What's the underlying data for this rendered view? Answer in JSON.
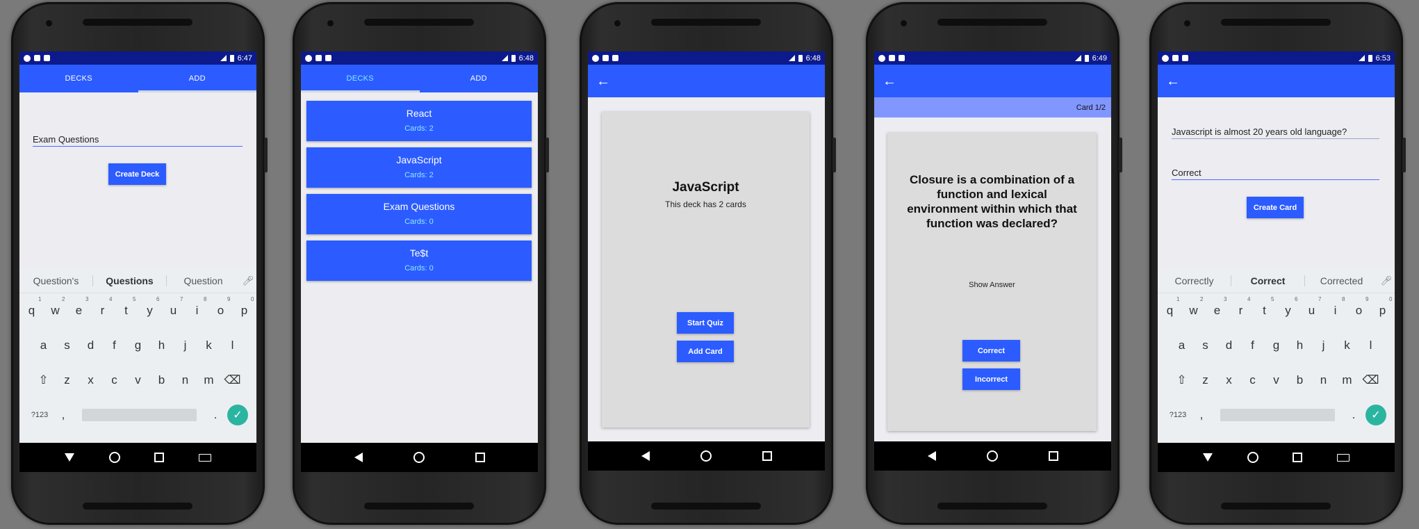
{
  "screens": [
    {
      "time": "6:47",
      "tabs": [
        "DECKS",
        "ADD"
      ],
      "active_tab": 1,
      "deck_title_value": "Exam Questions",
      "create_button": "Create Deck",
      "suggestions": [
        "Question's",
        "Questions",
        "Question"
      ]
    },
    {
      "time": "6:48",
      "tabs": [
        "DECKS",
        "ADD"
      ],
      "active_tab": 0,
      "decks": [
        {
          "title": "React",
          "cards": "Cards: 2"
        },
        {
          "title": "JavaScript",
          "cards": "Cards: 2"
        },
        {
          "title": "Exam Questions",
          "cards": "Cards: 0"
        },
        {
          "title": "Te$t",
          "cards": "Cards: 0"
        }
      ]
    },
    {
      "time": "6:48",
      "deck_title": "JavaScript",
      "deck_subtitle": "This deck has 2 cards",
      "start_quiz": "Start Quiz",
      "add_card": "Add Card"
    },
    {
      "time": "6:49",
      "progress": "Card 1/2",
      "question": "Closure is a combination of a function and lexical environment within which that function was declared?",
      "show_answer": "Show Answer",
      "correct": "Correct",
      "incorrect": "Incorrect"
    },
    {
      "time": "6:53",
      "question_value": "Javascript is almost 20 years old language?",
      "answer_value": "Correct",
      "create_button": "Create Card",
      "suggestions": [
        "Correctly",
        "Correct",
        "Corrected"
      ]
    }
  ],
  "keyboard": {
    "row1": [
      "q",
      "w",
      "e",
      "r",
      "t",
      "y",
      "u",
      "i",
      "o",
      "p"
    ],
    "row1_nums": [
      "1",
      "2",
      "3",
      "4",
      "5",
      "6",
      "7",
      "8",
      "9",
      "0"
    ],
    "row2": [
      "a",
      "s",
      "d",
      "f",
      "g",
      "h",
      "j",
      "k",
      "l"
    ],
    "row3": [
      "z",
      "x",
      "c",
      "v",
      "b",
      "n",
      "m"
    ],
    "sym": "?123",
    "comma": ",",
    "period": "."
  },
  "colors": {
    "primary": "#2c5cff",
    "status_bar": "#0c1a8c",
    "active_tab_text": "#7ef0ff",
    "card_count_text": "#8fe8ff",
    "progress_bar": "#8196ff",
    "enter_key": "#2bb5a0"
  }
}
